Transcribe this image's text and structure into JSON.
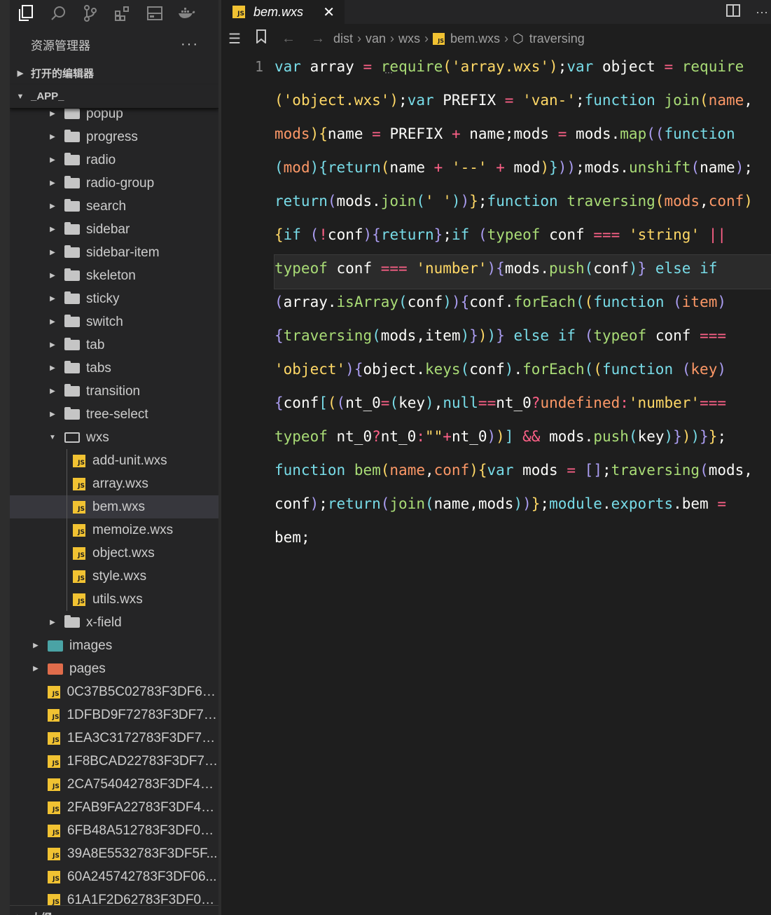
{
  "activity_icons": [
    "explorer-icon",
    "search-icon",
    "source-control-icon",
    "extensions-icon",
    "remote-icon",
    "docker-icon"
  ],
  "sidebar": {
    "title": "资源管理器",
    "more": "···",
    "open_editors": "打开的编辑器",
    "app_section": "_APP_",
    "outline": "大纲"
  },
  "tree": [
    {
      "label": "popup",
      "type": "folder",
      "level": 2
    },
    {
      "label": "progress",
      "type": "folder",
      "level": 2
    },
    {
      "label": "radio",
      "type": "folder",
      "level": 2
    },
    {
      "label": "radio-group",
      "type": "folder",
      "level": 2
    },
    {
      "label": "search",
      "type": "folder",
      "level": 2
    },
    {
      "label": "sidebar",
      "type": "folder",
      "level": 2
    },
    {
      "label": "sidebar-item",
      "type": "folder",
      "level": 2
    },
    {
      "label": "skeleton",
      "type": "folder",
      "level": 2
    },
    {
      "label": "sticky",
      "type": "folder",
      "level": 2
    },
    {
      "label": "switch",
      "type": "folder",
      "level": 2
    },
    {
      "label": "tab",
      "type": "folder",
      "level": 2
    },
    {
      "label": "tabs",
      "type": "folder",
      "level": 2
    },
    {
      "label": "transition",
      "type": "folder",
      "level": 2
    },
    {
      "label": "tree-select",
      "type": "folder",
      "level": 2
    },
    {
      "label": "wxs",
      "type": "folder-open",
      "level": 2
    },
    {
      "label": "add-unit.wxs",
      "type": "js",
      "level": 3
    },
    {
      "label": "array.wxs",
      "type": "js",
      "level": 3
    },
    {
      "label": "bem.wxs",
      "type": "js",
      "level": 3,
      "selected": true
    },
    {
      "label": "memoize.wxs",
      "type": "js",
      "level": 3
    },
    {
      "label": "object.wxs",
      "type": "js",
      "level": 3
    },
    {
      "label": "style.wxs",
      "type": "js",
      "level": 3
    },
    {
      "label": "utils.wxs",
      "type": "js",
      "level": 3
    },
    {
      "label": "x-field",
      "type": "folder",
      "level": 2
    },
    {
      "label": "images",
      "type": "img-folder",
      "level": 1
    },
    {
      "label": "pages",
      "type": "pages-folder",
      "level": 1
    },
    {
      "label": "0C37B5C02783F3DF6A...",
      "type": "js",
      "level": 1
    },
    {
      "label": "1DFBD9F72783F3DF7B...",
      "type": "js",
      "level": 1
    },
    {
      "label": "1EA3C3172783F3DF78...",
      "type": "js",
      "level": 1
    },
    {
      "label": "1F8BCAD22783F3DF79...",
      "type": "js",
      "level": 1
    },
    {
      "label": "2CA754042783F3DF4A...",
      "type": "js",
      "level": 1
    },
    {
      "label": "2FAB9FA22783F3DF49...",
      "type": "js",
      "level": 1
    },
    {
      "label": "6FB48A512783F3DF09...",
      "type": "js",
      "level": 1
    },
    {
      "label": "39A8E5532783F3DF5F...",
      "type": "js",
      "level": 1
    },
    {
      "label": "60A245742783F3DF06...",
      "type": "js",
      "level": 1
    },
    {
      "label": "61A1F2D62783F3DF07...",
      "type": "js",
      "level": 1
    }
  ],
  "tab": {
    "title": "bem.wxs",
    "close": "✕",
    "badge": "JS"
  },
  "breadcrumb": {
    "parts": [
      "dist",
      "van",
      "wxs"
    ],
    "file": "bem.wxs",
    "symbol": "traversing"
  },
  "editor": {
    "line_number": "1"
  }
}
